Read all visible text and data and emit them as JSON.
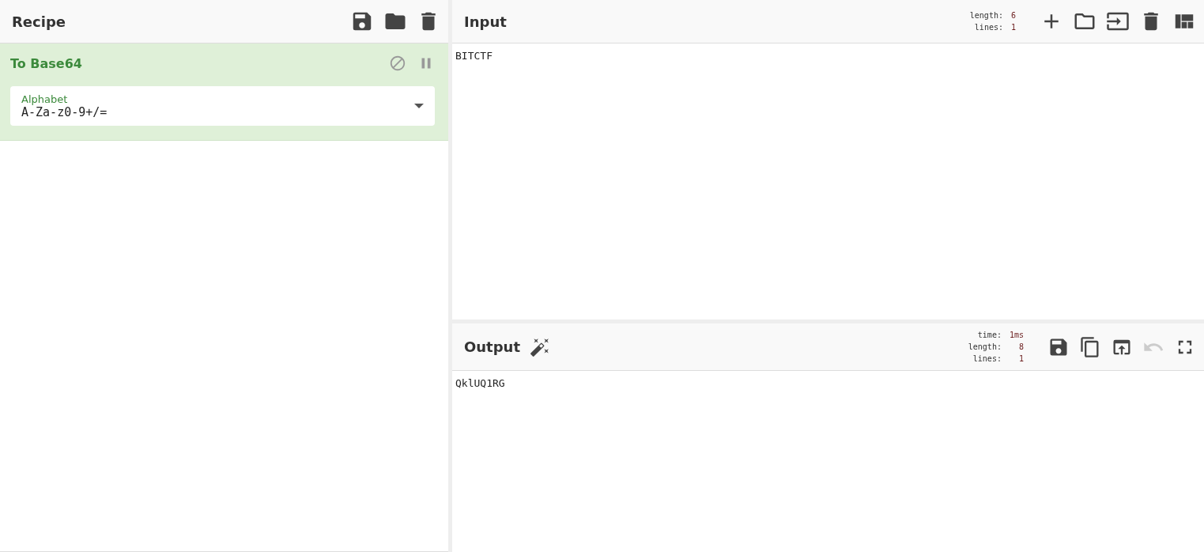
{
  "recipe": {
    "title": "Recipe",
    "buttons": [
      {
        "kind": "save"
      },
      {
        "kind": "load"
      },
      {
        "kind": "clear"
      }
    ],
    "operations": [
      {
        "name": "To Base64",
        "disabled": false,
        "breakpoint": false,
        "args": [
          {
            "label": "Alphabet",
            "value": "A-Za-z0-9+/="
          }
        ]
      }
    ]
  },
  "input": {
    "title": "Input",
    "stats": [
      {
        "label": "length:",
        "value": "6"
      },
      {
        "label": "lines:",
        "value": "1"
      }
    ],
    "buttons": [
      {
        "kind": "add",
        "disabled": false
      },
      {
        "kind": "open-folder",
        "disabled": false
      },
      {
        "kind": "open-file",
        "disabled": false
      },
      {
        "kind": "clear",
        "disabled": false
      },
      {
        "kind": "layout",
        "disabled": false
      }
    ],
    "text": "BITCTF"
  },
  "output": {
    "title": "Output",
    "stats": [
      {
        "label": "time:",
        "value": "1ms"
      },
      {
        "label": "length:",
        "value": "8"
      },
      {
        "label": "lines:",
        "value": "1"
      }
    ],
    "buttons": [
      {
        "kind": "save",
        "disabled": false
      },
      {
        "kind": "copy",
        "disabled": false
      },
      {
        "kind": "replace-input",
        "disabled": false
      },
      {
        "kind": "undo",
        "disabled": true
      },
      {
        "kind": "maximise",
        "disabled": false
      }
    ],
    "text": "QklUQ1RG"
  }
}
